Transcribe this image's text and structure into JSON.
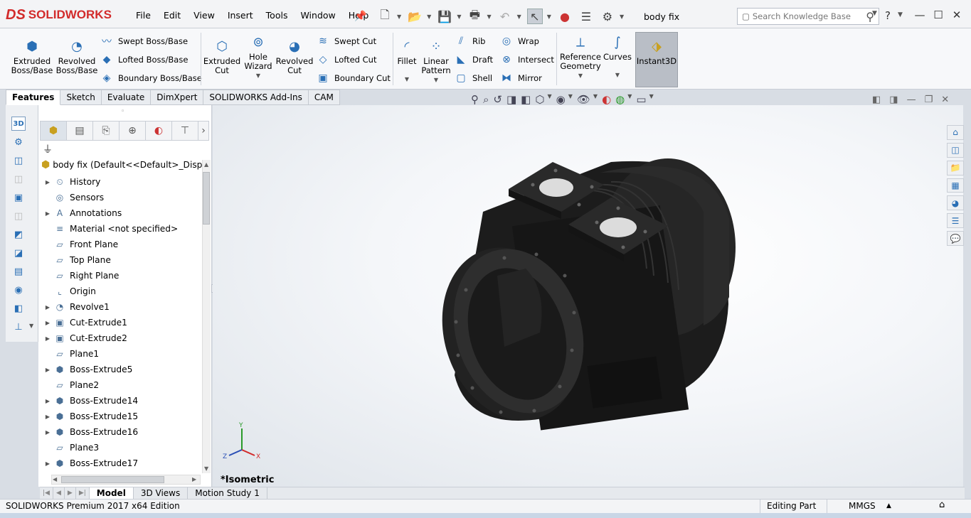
{
  "app": {
    "logo": "SOLIDWORKS",
    "logo_mark": "DS",
    "document_title": "body fix"
  },
  "menu": [
    "File",
    "Edit",
    "View",
    "Insert",
    "Tools",
    "Window",
    "Help"
  ],
  "search": {
    "placeholder": "Search Knowledge Base"
  },
  "help_label": "?",
  "ribbon": {
    "extruded_boss": "Extruded\nBoss/Base",
    "revolved_boss": "Revolved\nBoss/Base",
    "swept_boss": "Swept Boss/Base",
    "lofted_boss": "Lofted Boss/Base",
    "boundary_boss": "Boundary Boss/Base",
    "extruded_cut": "Extruded\nCut",
    "hole_wizard": "Hole\nWizard",
    "revolved_cut": "Revolved\nCut",
    "swept_cut": "Swept Cut",
    "lofted_cut": "Lofted Cut",
    "boundary_cut": "Boundary Cut",
    "fillet": "Fillet",
    "linear_pattern": "Linear\nPattern",
    "rib": "Rib",
    "draft": "Draft",
    "shell": "Shell",
    "wrap": "Wrap",
    "intersect": "Intersect",
    "mirror": "Mirror",
    "reference_geometry": "Reference\nGeometry",
    "curves": "Curves",
    "instant3d": "Instant3D"
  },
  "command_tabs": [
    "Features",
    "Sketch",
    "Evaluate",
    "DimXpert",
    "SOLIDWORKS Add-Ins",
    "CAM"
  ],
  "active_tab": "Features",
  "left_toolbar_badge": "3D",
  "feature_tree": {
    "root": "body fix  (Default<<Default>_Display S",
    "items": [
      {
        "label": "History",
        "expand": true,
        "icon": "history-icon"
      },
      {
        "label": "Sensors",
        "expand": false,
        "icon": "sensor-icon"
      },
      {
        "label": "Annotations",
        "expand": true,
        "icon": "annotation-icon"
      },
      {
        "label": "Material <not specified>",
        "expand": false,
        "icon": "material-icon"
      },
      {
        "label": "Front Plane",
        "expand": false,
        "icon": "plane-icon"
      },
      {
        "label": "Top Plane",
        "expand": false,
        "icon": "plane-icon"
      },
      {
        "label": "Right Plane",
        "expand": false,
        "icon": "plane-icon"
      },
      {
        "label": "Origin",
        "expand": false,
        "icon": "origin-icon"
      },
      {
        "label": "Revolve1",
        "expand": true,
        "icon": "revolve-icon"
      },
      {
        "label": "Cut-Extrude1",
        "expand": true,
        "icon": "cut-extrude-icon"
      },
      {
        "label": "Cut-Extrude2",
        "expand": true,
        "icon": "cut-extrude-icon"
      },
      {
        "label": "Plane1",
        "expand": false,
        "icon": "plane-icon"
      },
      {
        "label": "Boss-Extrude5",
        "expand": true,
        "icon": "boss-extrude-icon"
      },
      {
        "label": "Plane2",
        "expand": false,
        "icon": "plane-icon"
      },
      {
        "label": "Boss-Extrude14",
        "expand": true,
        "icon": "boss-extrude-icon"
      },
      {
        "label": "Boss-Extrude15",
        "expand": true,
        "icon": "boss-extrude-icon"
      },
      {
        "label": "Boss-Extrude16",
        "expand": true,
        "icon": "boss-extrude-icon"
      },
      {
        "label": "Plane3",
        "expand": false,
        "icon": "plane-icon"
      },
      {
        "label": "Boss-Extrude17",
        "expand": true,
        "icon": "boss-extrude-icon"
      }
    ]
  },
  "viewport": {
    "view_label": "*Isometric",
    "axis_x": "X",
    "axis_y": "Y",
    "axis_z": "Z"
  },
  "bottom_tabs": [
    "Model",
    "3D Views",
    "Motion Study 1"
  ],
  "active_bottom_tab": "Model",
  "status": {
    "edition": "SOLIDWORKS Premium 2017 x64 Edition",
    "mode": "Editing Part",
    "units": "MMGS"
  },
  "colors": {
    "brand": "#d22b2b",
    "accent": "#2a6fb5",
    "model": "#1a1a1a"
  }
}
